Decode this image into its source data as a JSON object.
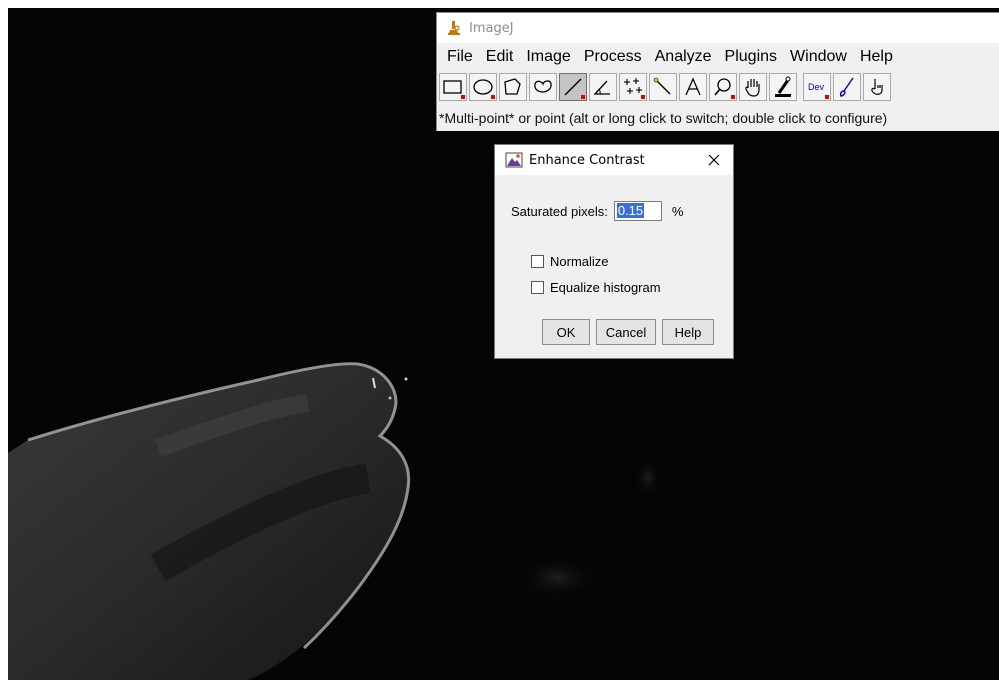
{
  "imagej": {
    "title": "ImageJ",
    "menu": [
      "File",
      "Edit",
      "Image",
      "Process",
      "Analyze",
      "Plugins",
      "Window",
      "Help"
    ],
    "tools": [
      {
        "name": "rectangle-tool",
        "icon": "rectangle-icon",
        "selected": false
      },
      {
        "name": "oval-tool",
        "icon": "oval-icon",
        "selected": false
      },
      {
        "name": "polygon-tool",
        "icon": "polygon-icon",
        "selected": false
      },
      {
        "name": "freehand-tool",
        "icon": "freehand-icon",
        "selected": false
      },
      {
        "name": "line-tool",
        "icon": "line-icon",
        "selected": true
      },
      {
        "name": "angle-tool",
        "icon": "angle-icon",
        "selected": false
      },
      {
        "name": "multipoint-tool",
        "icon": "multipoint-icon",
        "selected": false
      },
      {
        "name": "wand-tool",
        "icon": "wand-icon",
        "selected": false
      },
      {
        "name": "text-tool",
        "icon": "text-icon",
        "label": "A",
        "selected": false
      },
      {
        "name": "zoom-tool",
        "icon": "magnifier-icon",
        "selected": false
      },
      {
        "name": "hand-tool",
        "icon": "hand-icon",
        "selected": false
      },
      {
        "name": "color-picker-tool",
        "icon": "dropper-icon",
        "selected": false
      },
      {
        "name": "dev-tool",
        "icon": "dev-icon",
        "label": "Dev",
        "selected": false
      },
      {
        "name": "brush-tool",
        "icon": "brush-icon",
        "selected": false
      },
      {
        "name": "arrow-tool",
        "icon": "pointer-icon",
        "selected": false
      }
    ],
    "status": "*Multi-point* or point (alt or long click to switch; double click to configure)"
  },
  "dialog": {
    "title": "Enhance Contrast",
    "saturated_label": "Saturated pixels:",
    "saturated_value": "0.15",
    "saturated_unit": "%",
    "normalize_label": "Normalize",
    "normalize_checked": false,
    "equalize_label": "Equalize histogram",
    "equalize_checked": false,
    "ok_label": "OK",
    "cancel_label": "Cancel",
    "help_label": "Help"
  },
  "colors": {
    "accent_selection": "#3a6fd8",
    "tool_dropdown_marker": "#e00000",
    "image_background": "#050505"
  }
}
